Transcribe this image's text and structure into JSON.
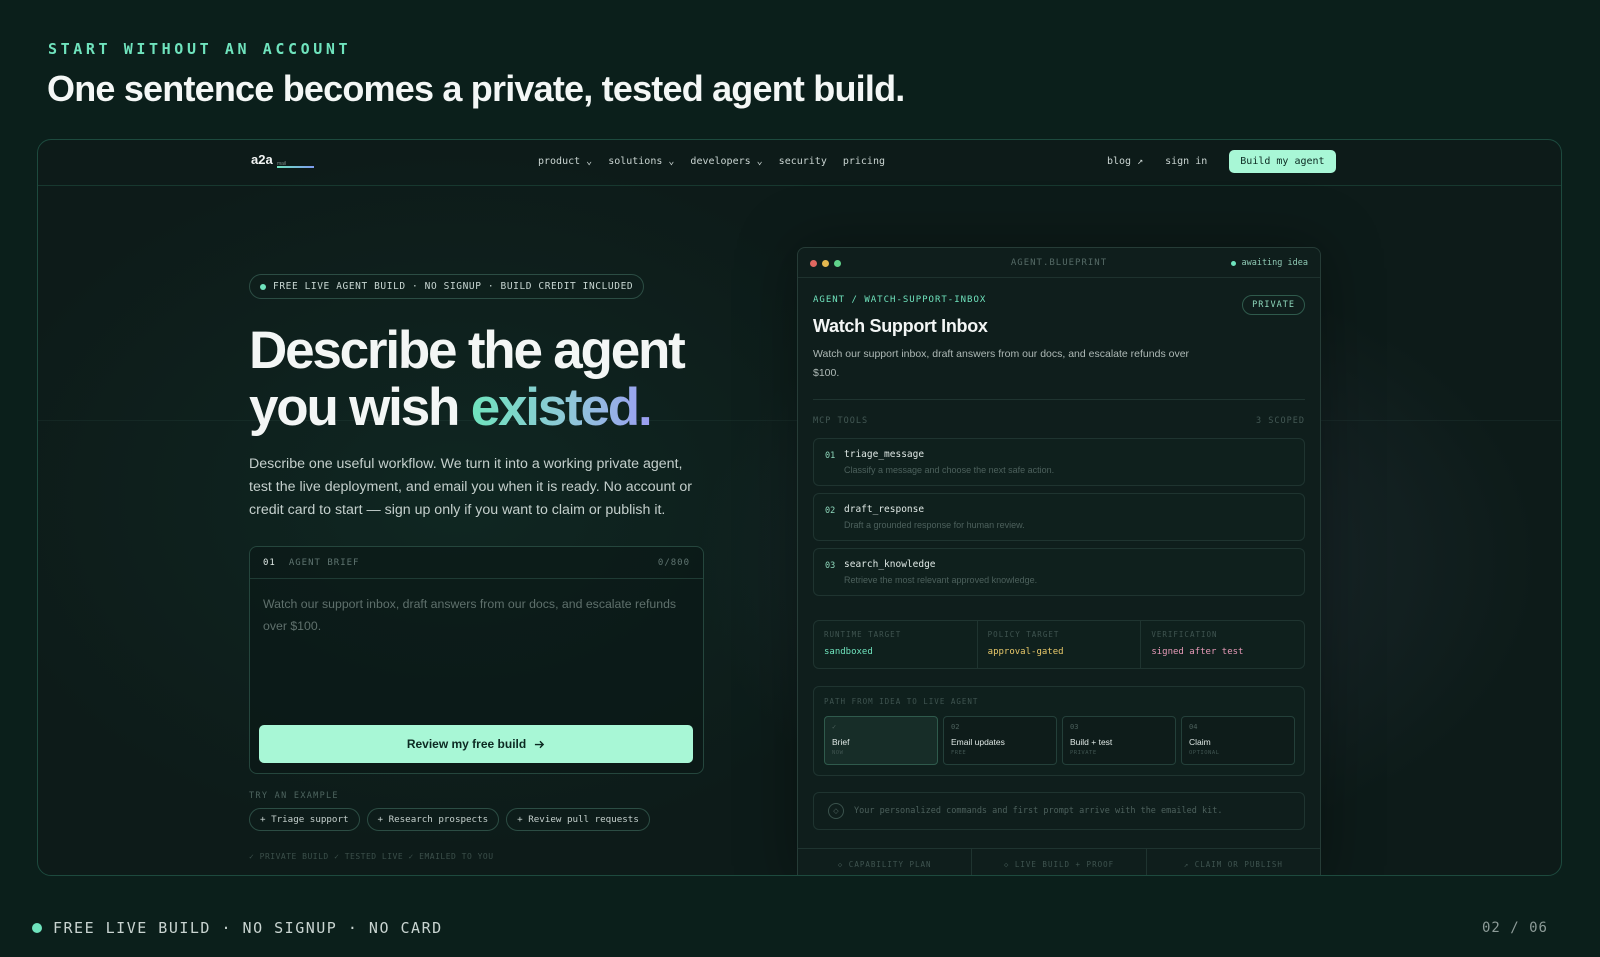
{
  "slide": {
    "eyebrow": "START WITHOUT AN ACCOUNT",
    "title": "One sentence becomes a private, tested agent build.",
    "footer_text": "FREE LIVE BUILD · NO SIGNUP · NO CARD",
    "page_indicator": "02 / 06"
  },
  "site_nav": {
    "logo": "a2a",
    "logo_sub": "mail",
    "links": [
      "product ⌄",
      "solutions ⌄",
      "developers ⌄",
      "security",
      "pricing"
    ],
    "blog": "blog ↗",
    "sign_in": "sign in",
    "cta": "Build my agent"
  },
  "hero": {
    "pill": "FREE LIVE AGENT BUILD · NO SIGNUP · BUILD CREDIT INCLUDED",
    "headline_line1": "Describe the agent",
    "headline_line2_plain": "you wish ",
    "headline_line2_accent": "existed.",
    "paragraph": "Describe one useful workflow. We turn it into a working private agent, test the live deployment, and email you when it is ready. No account or credit card to start — sign up only if you want to claim or publish it.",
    "brief": {
      "number": "01",
      "label": "AGENT BRIEF",
      "counter": "0/800",
      "placeholder": "Watch our support inbox, draft answers from our docs, and escalate refunds over $100.",
      "button": "Review my free build"
    },
    "try_label": "TRY AN EXAMPLE",
    "examples": [
      "+ Triage support",
      "+ Research prospects",
      "+ Review pull requests"
    ],
    "faded_row": "✓ PRIVATE BUILD   ✓ TESTED LIVE   ✓ EMAILED TO YOU"
  },
  "blueprint": {
    "file_name": "AGENT.BLUEPRINT",
    "status": "awaiting idea",
    "breadcrumb": "AGENT / WATCH-SUPPORT-INBOX",
    "badge": "PRIVATE",
    "title": "Watch Support Inbox",
    "description": "Watch our support inbox, draft answers from our docs, and escalate refunds over $100.",
    "tools_label": "MCP TOOLS",
    "tools_count": "3 SCOPED",
    "tools": [
      {
        "num": "01",
        "name": "triage_message",
        "desc": "Classify a message and choose the next safe action."
      },
      {
        "num": "02",
        "name": "draft_response",
        "desc": "Draft a grounded response for human review."
      },
      {
        "num": "03",
        "name": "search_knowledge",
        "desc": "Retrieve the most relevant approved knowledge."
      }
    ],
    "targets": [
      {
        "label": "RUNTIME TARGET",
        "value": "sandboxed",
        "color": "#6fe3bd"
      },
      {
        "label": "POLICY TARGET",
        "value": "approval-gated",
        "color": "#e8c86a"
      },
      {
        "label": "VERIFICATION",
        "value": "signed after test",
        "color": "#e79ab8"
      }
    ],
    "path_label": "PATH FROM IDEA TO LIVE AGENT",
    "steps": [
      {
        "key": "✓",
        "name": "Brief",
        "sub": "NOW"
      },
      {
        "key": "02",
        "name": "Email updates",
        "sub": "FREE"
      },
      {
        "key": "03",
        "name": "Build + test",
        "sub": "PRIVATE"
      },
      {
        "key": "04",
        "name": "Claim",
        "sub": "OPTIONAL"
      }
    ],
    "kit_text": "Your personalized commands and first prompt arrive with the emailed kit.",
    "tabs": [
      "◇ CAPABILITY PLAN",
      "◇ LIVE BUILD + PROOF",
      "↗ CLAIM OR PUBLISH"
    ]
  },
  "colors": {
    "accent": "#6fe3bd",
    "cta_bg": "#a8f7d6",
    "background": "#0b1f1b"
  }
}
